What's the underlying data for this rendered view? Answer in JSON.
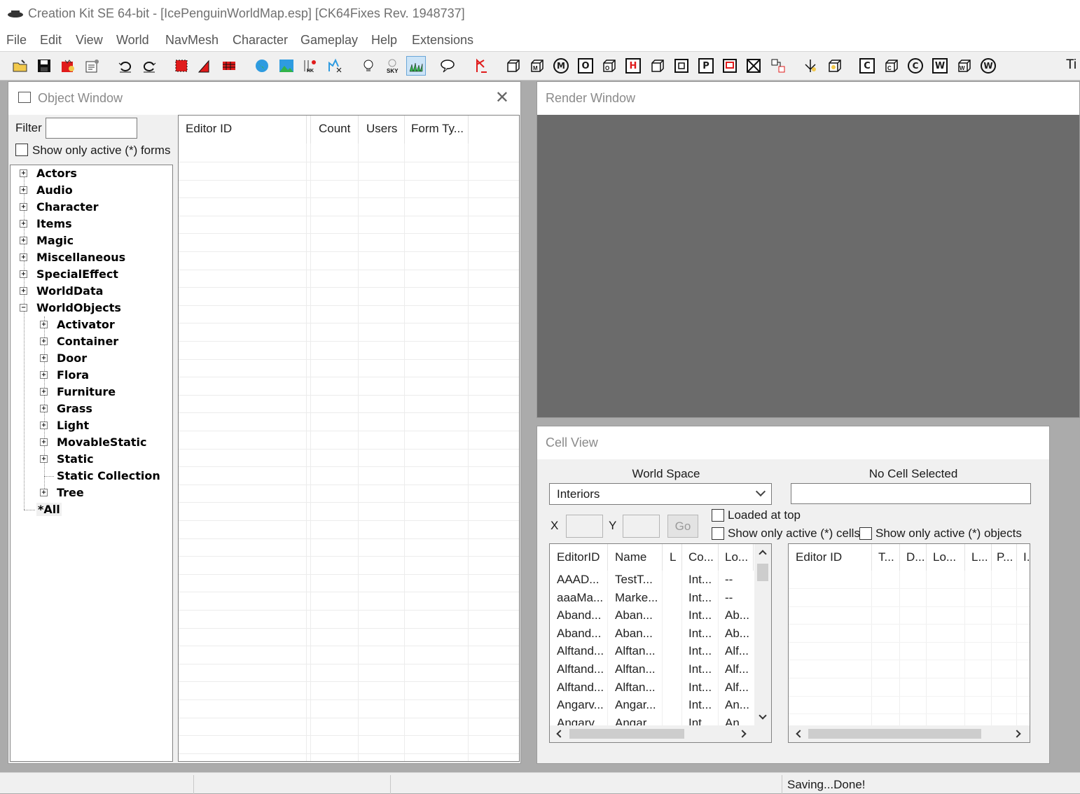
{
  "window": {
    "title": "Creation Kit SE 64-bit - [IcePenguinWorldMap.esp] [CK64Fixes Rev. 1948737]"
  },
  "menu": [
    "File",
    "Edit",
    "View",
    "World",
    "NavMesh",
    "Character",
    "Gameplay",
    "Help",
    "Extensions"
  ],
  "toolbar": {
    "letters": {
      "o": "O",
      "h": "H",
      "p": "P",
      "c": "C",
      "w": "W",
      "w2": "W"
    },
    "overflow": "Ti"
  },
  "object_window": {
    "title": "Object Window",
    "filter_label": "Filter",
    "filter_value": "",
    "show_active_label": "Show only active (*) forms",
    "tree": {
      "top": [
        "Actors",
        "Audio",
        "Character",
        "Items",
        "Magic",
        "Miscellaneous",
        "SpecialEffect",
        "WorldData",
        "WorldObjects"
      ],
      "children": [
        "Activator",
        "Container",
        "Door",
        "Flora",
        "Furniture",
        "Grass",
        "Light",
        "MovableStatic",
        "Static",
        "Static Collection",
        "Tree"
      ],
      "all": "*All"
    },
    "columns": [
      "Editor ID",
      "Count",
      "Users",
      "Form Ty..."
    ]
  },
  "render_window": {
    "title": "Render Window"
  },
  "cell_view": {
    "title": "Cell View",
    "world_space_label": "World Space",
    "world_space_value": "Interiors",
    "no_cell_label": "No Cell Selected",
    "x_label": "X",
    "y_label": "Y",
    "go_label": "Go",
    "loaded_at_top": "Loaded at top",
    "show_active_cells": "Show only active (*) cells",
    "show_active_objects": "Show only active (*) objects",
    "cells_columns": [
      "EditorID",
      "Name",
      "L",
      "Co...",
      "Lo..."
    ],
    "cells_rows": [
      [
        "AAAD...",
        "TestT...",
        "",
        "Int...",
        "--"
      ],
      [
        "aaaMa...",
        "Marke...",
        "",
        "Int...",
        "--"
      ],
      [
        "Aband...",
        "Aban...",
        "",
        "Int...",
        "Ab..."
      ],
      [
        "Aband...",
        "Aban...",
        "",
        "Int...",
        "Ab..."
      ],
      [
        "Alftand...",
        "Alftan...",
        "",
        "Int...",
        "Alf..."
      ],
      [
        "Alftand...",
        "Alftan...",
        "",
        "Int...",
        "Alf..."
      ],
      [
        "Alftand...",
        "Alftan...",
        "",
        "Int...",
        "Alf..."
      ],
      [
        "Angarv...",
        "Angar...",
        "",
        "Int...",
        "An..."
      ],
      [
        "Angarv...",
        "Angar...",
        "",
        "Int...",
        "An..."
      ]
    ],
    "objects_columns": [
      "Editor ID",
      "T...",
      "D...",
      "Lo...",
      "L...",
      "P...",
      "I..."
    ]
  },
  "statusbar": {
    "text": "Saving...Done!"
  },
  "colors": {
    "render_bg": "#6b6b6b",
    "toolbar_active": "#cce4f7",
    "red_icon": "#e01b1b"
  }
}
